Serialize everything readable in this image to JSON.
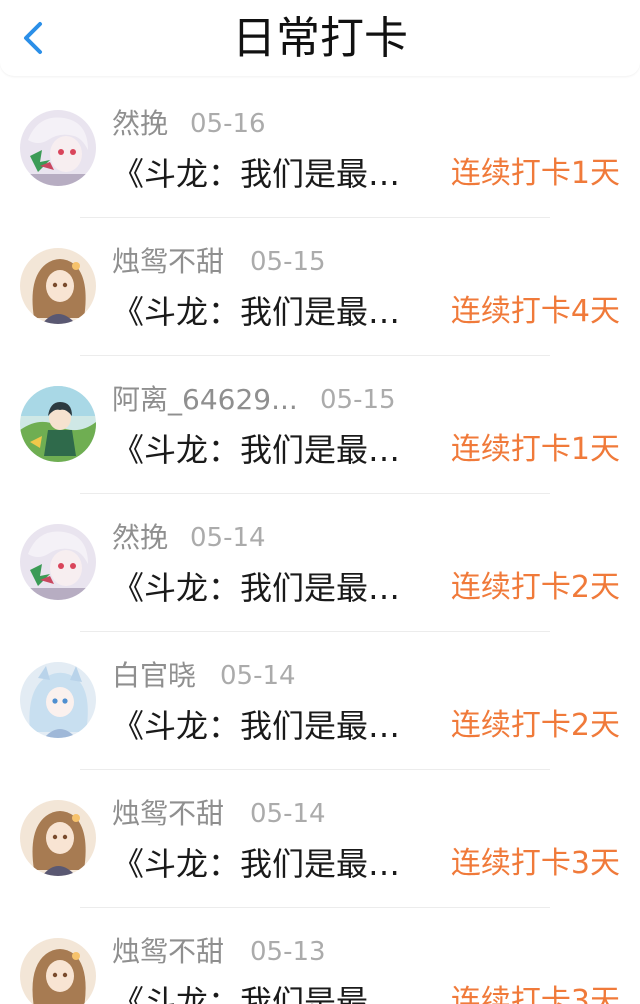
{
  "header": {
    "title": "日常打卡",
    "back_icon": "chevron-left-icon",
    "accent_color": "#2b8fe8"
  },
  "streak_color": "#f07a3a",
  "items": [
    {
      "username": "然挽",
      "date": "05-16",
      "title": "《斗龙：我们是最强的战队》",
      "streak": "连续打卡1天",
      "avatar": "avatar-white-hair-girl"
    },
    {
      "username": "烛鸳不甜",
      "date": "05-15",
      "title": "《斗龙：我们是最强的战队》",
      "streak": "连续打卡4天",
      "avatar": "avatar-brown-hair-girl"
    },
    {
      "username": "阿离_64629...",
      "date": "05-15",
      "title": "《斗龙：我们是最强的战队》",
      "streak": "连续打卡1天",
      "avatar": "avatar-green-character"
    },
    {
      "username": "然挽",
      "date": "05-14",
      "title": "《斗龙：我们是最强的战队》",
      "streak": "连续打卡2天",
      "avatar": "avatar-white-hair-girl"
    },
    {
      "username": "白官晓",
      "date": "05-14",
      "title": "《斗龙：我们是最强的战队》",
      "streak": "连续打卡2天",
      "avatar": "avatar-blue-hair-girl"
    },
    {
      "username": "烛鸳不甜",
      "date": "05-14",
      "title": "《斗龙：我们是最强的战队》",
      "streak": "连续打卡3天",
      "avatar": "avatar-brown-hair-girl"
    },
    {
      "username": "烛鸳不甜",
      "date": "05-13",
      "title": "《斗龙：我们是最强的战队》",
      "streak": "连续打卡3天",
      "avatar": "avatar-brown-hair-girl"
    }
  ]
}
